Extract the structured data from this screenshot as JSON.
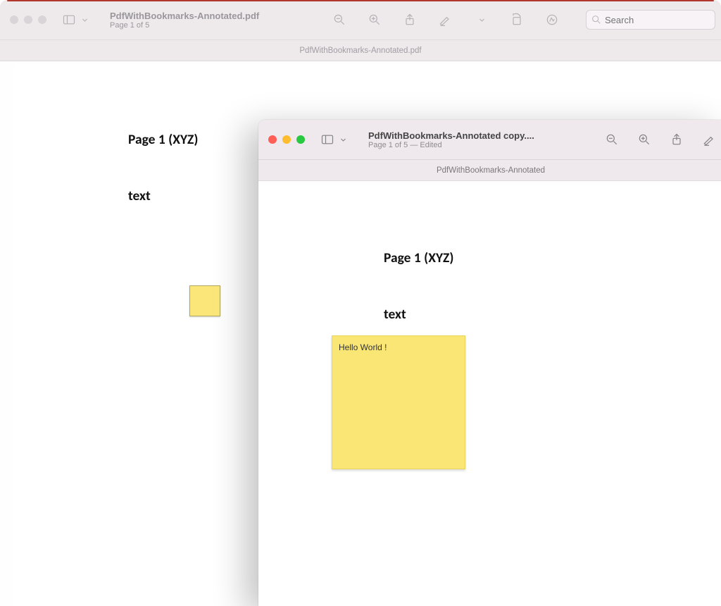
{
  "window_back": {
    "title": "PdfWithBookmarks-Annotated.pdf",
    "subtitle": "Page 1 of 5",
    "tab_label": "PdfWithBookmarks-Annotated.pdf",
    "search_placeholder": "Search",
    "page": {
      "heading": "Page 1 (XYZ)",
      "body": "text"
    }
  },
  "window_front": {
    "title": "PdfWithBookmarks-Annotated copy....",
    "subtitle": "Page 1 of 5 — Edited",
    "tab_label": "PdfWithBookmarks-Annotated",
    "page": {
      "heading": "Page 1 (XYZ)",
      "body": "text",
      "note_text": "Hello World !"
    }
  }
}
